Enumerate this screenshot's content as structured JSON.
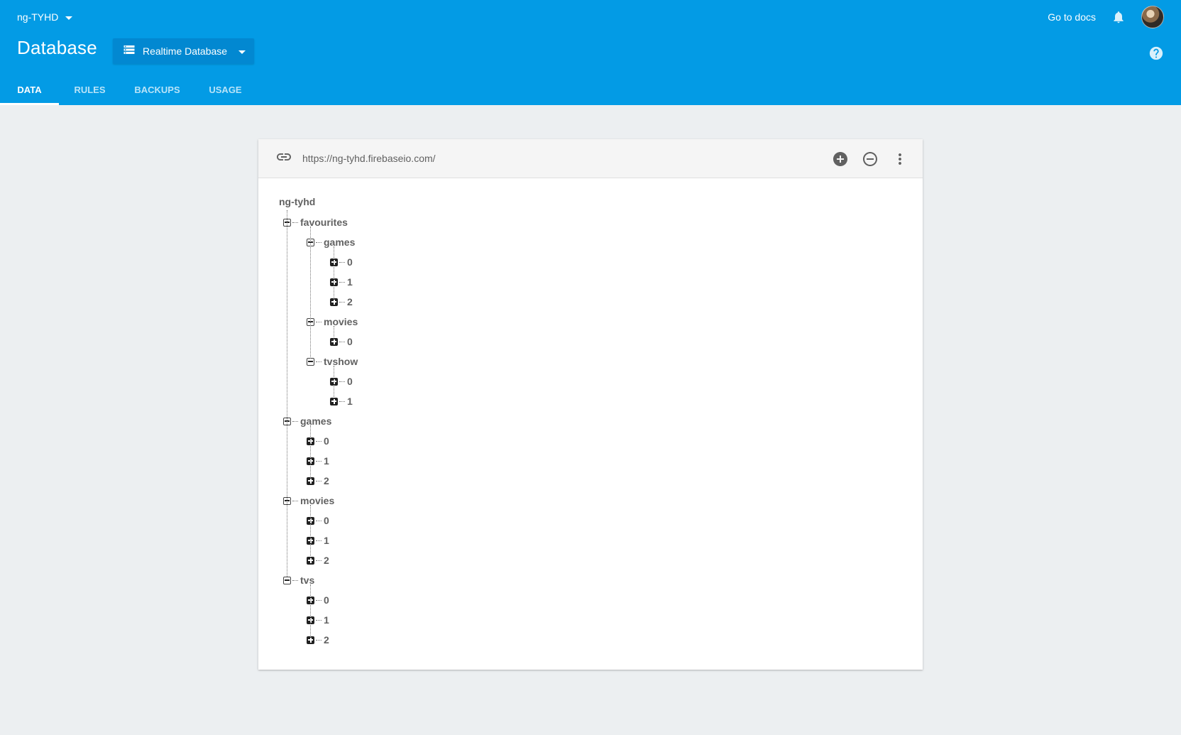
{
  "header": {
    "project_name": "ng-TYHD",
    "docs_link": "Go to docs",
    "title": "Database",
    "db_selector_label": "Realtime Database",
    "notification_icon": "bell-icon",
    "help_icon": "help-circle-icon",
    "tabs": [
      {
        "label": "DATA",
        "active": true
      },
      {
        "label": "RULES",
        "active": false
      },
      {
        "label": "BACKUPS",
        "active": false
      },
      {
        "label": "USAGE",
        "active": false
      }
    ]
  },
  "toolbar": {
    "url": "https://ng-tyhd.firebaseio.com/",
    "link_icon": "link-icon",
    "expand_icon": "add-circle-icon",
    "collapse_icon": "remove-circle-outline-icon",
    "menu_icon": "more-vert-icon"
  },
  "tree": {
    "root": "ng-tyhd",
    "nodes": [
      {
        "label": "favourites",
        "level": 1,
        "state": "expanded"
      },
      {
        "label": "games",
        "level": 2,
        "state": "expanded"
      },
      {
        "label": "0",
        "level": 3,
        "state": "collapsed"
      },
      {
        "label": "1",
        "level": 3,
        "state": "collapsed"
      },
      {
        "label": "2",
        "level": 3,
        "state": "collapsed"
      },
      {
        "label": "movies",
        "level": 2,
        "state": "expanded"
      },
      {
        "label": "0",
        "level": 3,
        "state": "collapsed"
      },
      {
        "label": "tvshow",
        "level": 2,
        "state": "expanded"
      },
      {
        "label": "0",
        "level": 3,
        "state": "collapsed"
      },
      {
        "label": "1",
        "level": 3,
        "state": "collapsed"
      },
      {
        "label": "games",
        "level": 1,
        "state": "expanded"
      },
      {
        "label": "0",
        "level": 2,
        "state": "collapsed"
      },
      {
        "label": "1",
        "level": 2,
        "state": "collapsed"
      },
      {
        "label": "2",
        "level": 2,
        "state": "collapsed"
      },
      {
        "label": "movies",
        "level": 1,
        "state": "expanded"
      },
      {
        "label": "0",
        "level": 2,
        "state": "collapsed"
      },
      {
        "label": "1",
        "level": 2,
        "state": "collapsed"
      },
      {
        "label": "2",
        "level": 2,
        "state": "collapsed"
      },
      {
        "label": "tvs",
        "level": 1,
        "state": "expanded"
      },
      {
        "label": "0",
        "level": 2,
        "state": "collapsed"
      },
      {
        "label": "1",
        "level": 2,
        "state": "collapsed"
      },
      {
        "label": "2",
        "level": 2,
        "state": "collapsed"
      }
    ]
  }
}
